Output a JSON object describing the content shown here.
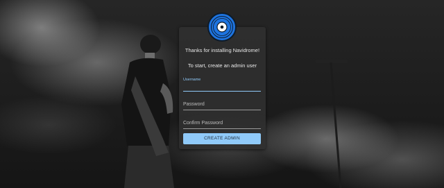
{
  "app": {
    "logo": "vinyl-record-icon",
    "accent_color": "#90caf9",
    "logo_color": "#1e74e0"
  },
  "card": {
    "welcome_text": "Thanks for installing Navidrome!",
    "instruction_text": "To start, create an admin user"
  },
  "form": {
    "username": {
      "label": "Username",
      "value": ""
    },
    "password": {
      "label": "Password",
      "value": ""
    },
    "confirm_password": {
      "label": "Confirm Password",
      "value": ""
    },
    "submit_label": "CREATE ADMIN"
  }
}
